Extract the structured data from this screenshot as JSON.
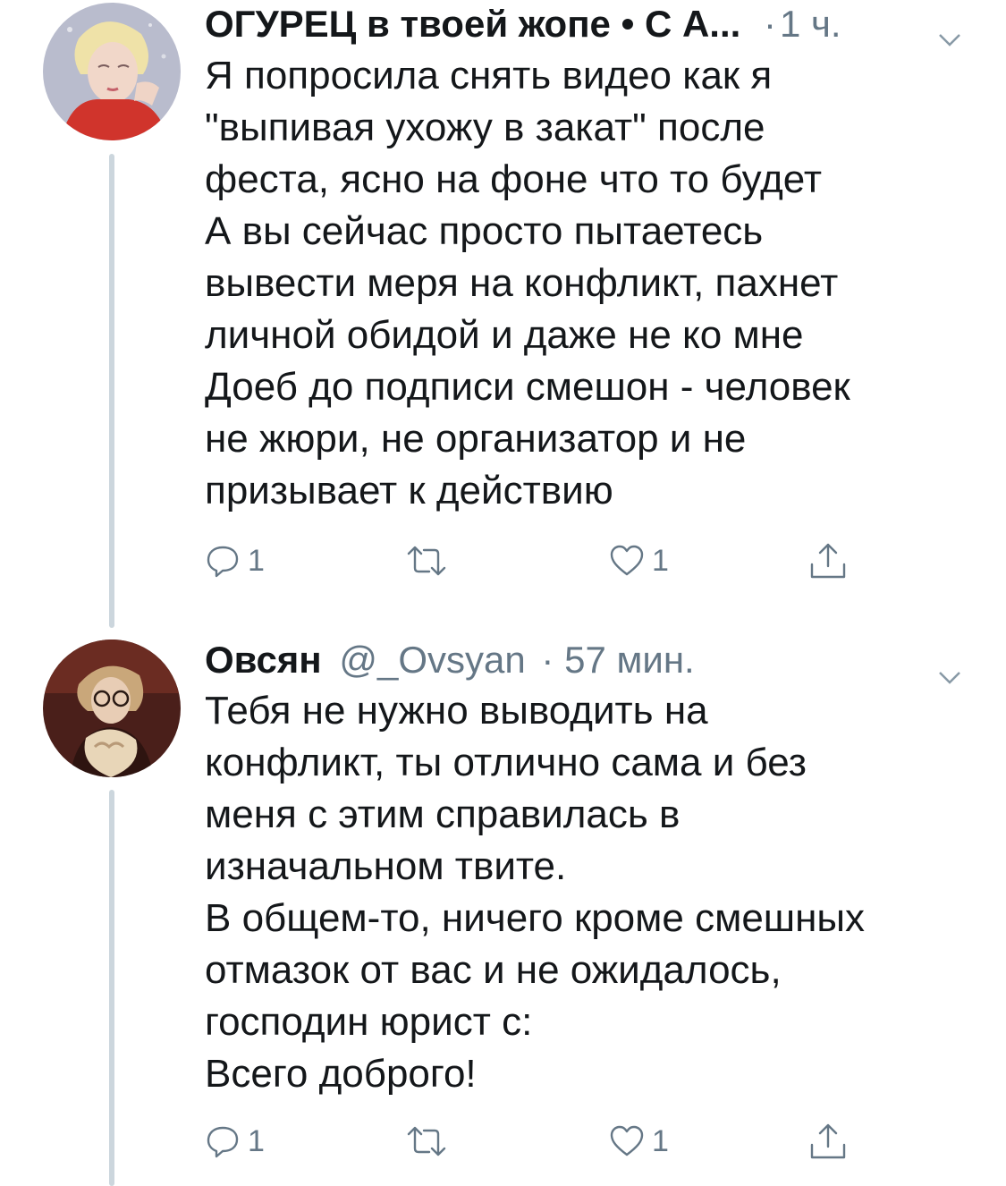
{
  "tweets": [
    {
      "name": "ОГУРЕЦ в твоей жопе • С А...",
      "handle": "",
      "separator": "·",
      "time": "1 ч.",
      "body": "Я попросила снять видео как я\n\"выпивая ухожу в закат\" после\nфеста, ясно на фоне что то будет\nА вы сейчас просто пытаетесь\nвывести меря на конфликт, пахнет\nличной обидой и даже не ко мне\nДоеб до подписи смешон - человек\nне жюри, не организатор и не\nпризывает к действию",
      "reply_count": "1",
      "retweet_count": "",
      "like_count": "1",
      "avatar_icon": "avatar-red-scarf",
      "colors": {
        "avatar_bg": "#c7c9d6",
        "scarf": "#d0342c"
      }
    },
    {
      "name": "Овсян",
      "handle": "@_Ovsyan",
      "separator": "·",
      "time": "57 мин.",
      "body": "Тебя не нужно выводить на\nконфликт, ты отлично сама и без\nменя с этим справилась в\nизначальном твите.\nВ общем-то, ничего кроме смешных\nотмазок от вас и не ожидалось,\nгосподин юрист с:\nВсего доброго!",
      "reply_count": "1",
      "retweet_count": "",
      "like_count": "1",
      "avatar_icon": "avatar-glasses",
      "colors": {
        "avatar_bg": "#5a2a22",
        "accent": "#e8d6b8"
      }
    }
  ],
  "icons": {
    "reply": "reply-icon",
    "retweet": "retweet-icon",
    "like": "heart-icon",
    "share": "share-icon",
    "caret": "chevron-down-icon"
  },
  "colors": {
    "text": "#14171a",
    "secondary": "#657786",
    "thread_line": "#ccd6dd"
  }
}
